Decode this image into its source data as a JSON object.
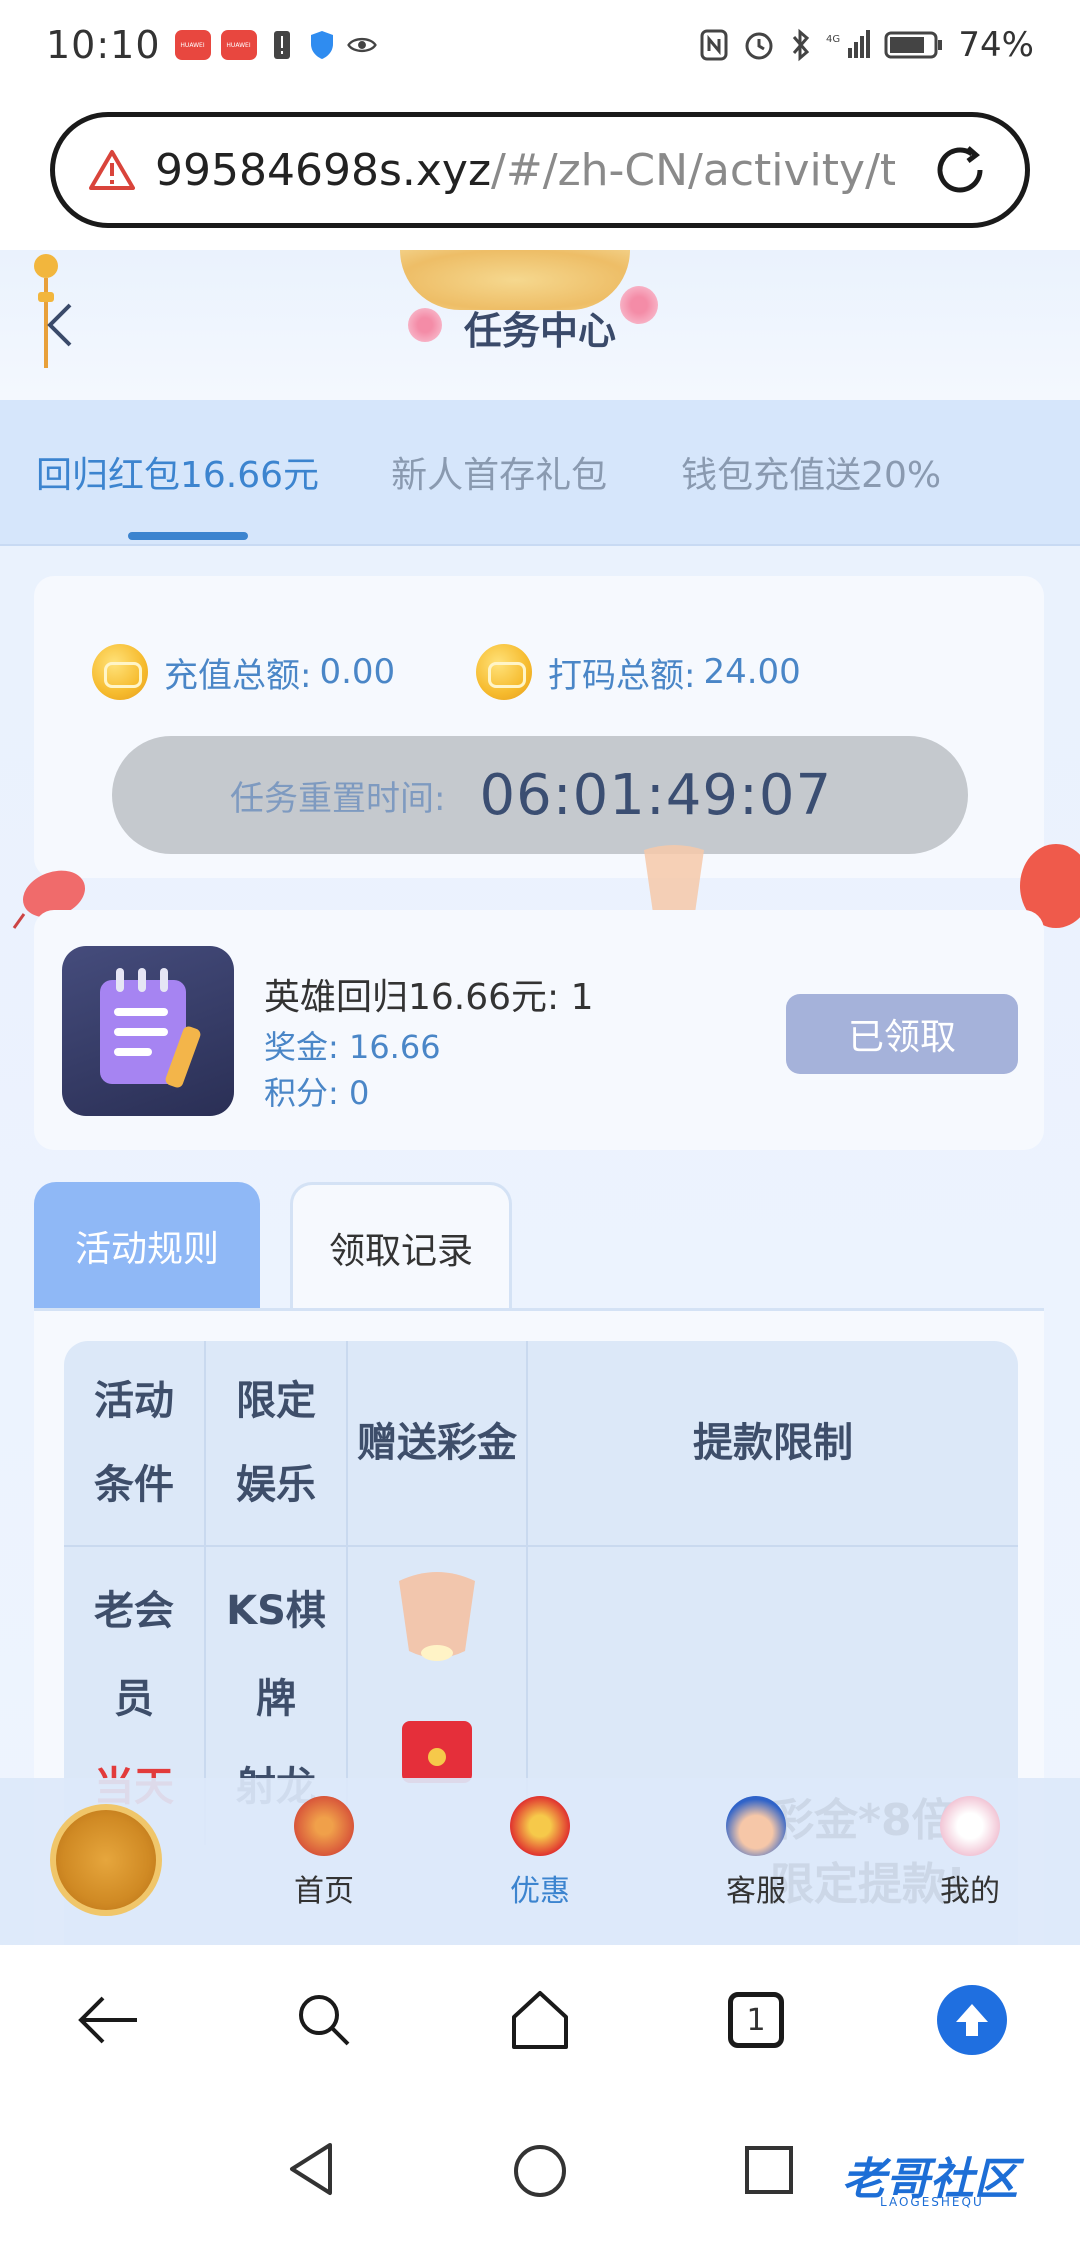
{
  "status_bar": {
    "time": "10:10",
    "battery": "74%",
    "signal": "4G"
  },
  "address_bar": {
    "url_host": "99584698s.xyz",
    "url_path": "/#/zh-CN/activity/t"
  },
  "header": {
    "title": "任务中心"
  },
  "tabs": [
    {
      "label": "回归红包16.66元"
    },
    {
      "label": "新人首存礼包"
    },
    {
      "label": "钱包充值送20%"
    }
  ],
  "stats": {
    "deposit_label": "充值总额:",
    "deposit_value": "0.00",
    "wager_label": "打码总额:",
    "wager_value": "24.00",
    "reset_label": "任务重置时间:",
    "reset_time": "06:01:49:07"
  },
  "task": {
    "title": "英雄回归16.66元: 1",
    "bonus": "奖金: 16.66",
    "points": "积分: 0",
    "button": "已领取"
  },
  "rule_tabs": {
    "rules": "活动规则",
    "records": "领取记录"
  },
  "rules_table": {
    "headers": [
      "活动\n条件",
      "限定\n娱乐",
      "赠送彩金",
      "提款限制"
    ],
    "row1": {
      "col1_line1": "老会",
      "col1_line2": "员",
      "col1_line3": "当天",
      "col2_line1": "KS棋",
      "col2_line2": "牌",
      "col2_line3": "射龙"
    }
  },
  "site_nav": {
    "items": [
      "首页",
      "优惠",
      "客服",
      "我的"
    ],
    "overlay_1": "彩金*8倍",
    "overlay_2": "限定提款!"
  },
  "browser_toolbar": {
    "tab_count": "1"
  },
  "watermark": {
    "text": "老哥社区",
    "sub": "LAOGESHEQU"
  },
  "colors": {
    "accent": "#3c84cf",
    "claimed": "#a5b2da",
    "rule_tab_active": "#8fb8f6",
    "red": "#e23b3b"
  }
}
